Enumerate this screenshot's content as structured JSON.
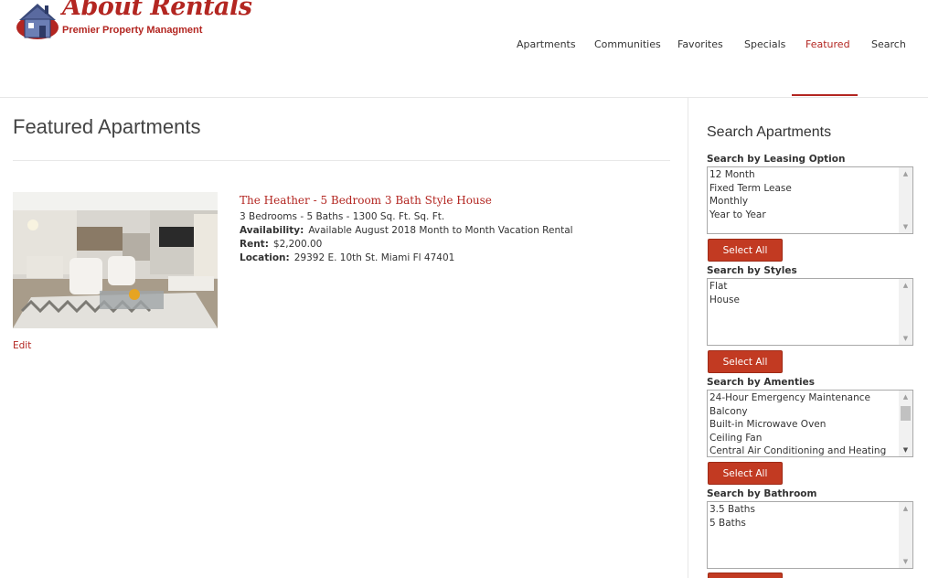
{
  "brand": {
    "title": "About Rentals",
    "tagline": "Premier Property Managment"
  },
  "nav": {
    "items": [
      {
        "label": "Apartments",
        "active": false
      },
      {
        "label": "Communities",
        "active": false
      },
      {
        "label": "Favorites",
        "active": false
      },
      {
        "label": "Specials",
        "active": false
      },
      {
        "label": "Featured",
        "active": true
      },
      {
        "label": "Search",
        "active": false
      }
    ]
  },
  "main": {
    "page_title": "Featured Apartments",
    "listing": {
      "title": "The Heather - 5 Bedroom 3 Bath Style House",
      "summary": "3 Bedrooms - 5 Baths - 1300 Sq. Ft. Sq. Ft.",
      "availability_label": "Availability:",
      "availability_value": "Available August 2018 Month to Month Vacation Rental",
      "rent_label": "Rent:",
      "rent_value": "$2,200.00",
      "location_label": "Location:",
      "location_value": "29392 E. 10th St. Miami Fl 47401",
      "edit_label": "Edit"
    }
  },
  "sidebar": {
    "title": "Search Apartments",
    "groups": [
      {
        "label": "Search by Leasing Option",
        "options": [
          "12 Month",
          "Fixed Term Lease",
          "Monthly",
          "Year to Year"
        ],
        "button": "Select All"
      },
      {
        "label": "Search by Styles",
        "options": [
          "Flat",
          "House"
        ],
        "button": "Select All"
      },
      {
        "label": "Search by Amenties",
        "options": [
          "24-Hour Emergency Maintenance",
          "Balcony",
          "Built-in Microwave Oven",
          "Ceiling Fan",
          "Central Air Conditioning and Heating"
        ],
        "button": "Select All"
      },
      {
        "label": "Search by Bathroom",
        "options": [
          "3.5 Baths",
          "5 Baths"
        ],
        "button": ""
      }
    ]
  },
  "colors": {
    "accent": "#b32621",
    "button": "#c23a22",
    "text": "#333333"
  },
  "icons": {
    "logo": "house-icon",
    "scroll_up": "triangle-up-icon",
    "scroll_down": "triangle-down-icon"
  }
}
